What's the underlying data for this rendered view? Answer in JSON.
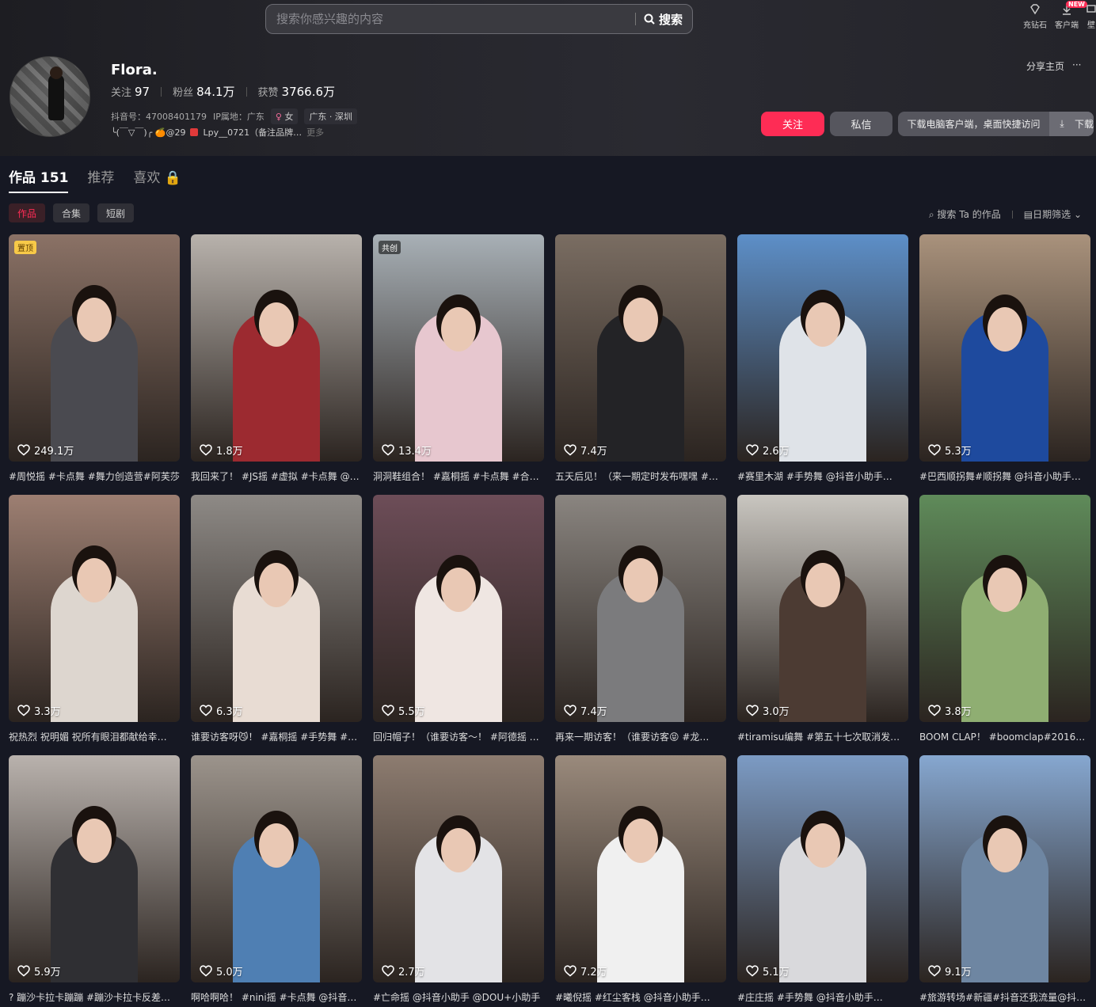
{
  "search": {
    "placeholder": "搜索你感兴趣的内容",
    "button": "搜索"
  },
  "topbar": {
    "recharge": "充钻石",
    "client": "客户端",
    "new_badge": "NEW",
    "extra": "壁"
  },
  "profile": {
    "name": "Flora.",
    "following_label": "关注",
    "following": "97",
    "fans_label": "粉丝",
    "fans": "84.1万",
    "likes_label": "获赞",
    "likes": "3766.6万",
    "douyin_id": "抖音号：47008401179",
    "ip": "IP属地：广东",
    "gender": "女",
    "location": "广东 · 深圳",
    "bio": "╰(￣▽￣)╭ 🍊@29",
    "bio_link": "Lpy__0721（备注品牌…",
    "more": "更多"
  },
  "header_actions": {
    "share": "分享主页",
    "more": "···",
    "follow": "关注",
    "message": "私信",
    "download_tip": "下载电脑客户端，桌面快捷访问",
    "download": "下载"
  },
  "tabs": [
    {
      "label": "作品 151"
    },
    {
      "label": "推荐"
    },
    {
      "label": "喜欢"
    }
  ],
  "subtabs": [
    {
      "label": "作品"
    },
    {
      "label": "合集"
    },
    {
      "label": "短剧"
    }
  ],
  "tools": {
    "search_works": "搜索 Ta 的作品",
    "date_filter": "日期筛选"
  },
  "videos": [
    {
      "likes": "249.1万",
      "caption": "#周悦摇 #卡点舞 #舞力创造营#阿芙莎",
      "badge": "置顶",
      "bg": "#8b7266",
      "shirt": "#4a4a50"
    },
    {
      "likes": "1.8万",
      "caption": "我回来了！ #JS摇 #虚拟 #卡点舞 @…",
      "bg": "#b8b2ac",
      "shirt": "#9c2a30"
    },
    {
      "likes": "13.4万",
      "caption": "洞洞鞋组合！ #嘉桐摇 #卡点舞 #合…",
      "badge": "共创",
      "bg": "#a8b0b6",
      "shirt": "#e7c7cf"
    },
    {
      "likes": "7.4万",
      "caption": "五天后见！（来一期定时发布嘿嘿 #…",
      "bg": "#7a6d62",
      "shirt": "#232326"
    },
    {
      "likes": "2.6万",
      "caption": "#赛里木湖 #手势舞 @抖音小助手…",
      "bg": "#5d8fc8",
      "shirt": "#dfe3e8"
    },
    {
      "likes": "5.3万",
      "caption": "#巴西顺拐舞#顺拐舞 @抖音小助手…",
      "bg": "#a9927c",
      "shirt": "#1e4a9e"
    },
    {
      "likes": "3.3万",
      "caption": "祝热烈 祝明媚 祝所有眼泪都献给幸…",
      "bg": "#9d7f72",
      "shirt": "#ddd6cf"
    },
    {
      "likes": "6.3万",
      "caption": "谁要访客呀😼！ #嘉桐摇 #手势舞 #…",
      "bg": "#8e8a86",
      "shirt": "#e8dcd3"
    },
    {
      "likes": "5.5万",
      "caption": "回归帽子！（谁要访客～！ #阿德摇 …",
      "bg": "#6d4d58",
      "shirt": "#efe6e2"
    },
    {
      "likes": "7.4万",
      "caption": "再来一期访客！（谁要访客😝 #龙…",
      "bg": "#8a8580",
      "shirt": "#7b7b7d"
    },
    {
      "likes": "3.0万",
      "caption": "#tiramisu编舞 #第五十七次取消发…",
      "bg": "#c9c6c0",
      "shirt": "#4c3b33"
    },
    {
      "likes": "3.8万",
      "caption": "BOOM CLAP！ #boomclap#2016…",
      "bg": "#5f8b5a",
      "shirt": "#8fae72"
    },
    {
      "likes": "5.9万",
      "caption": "? 蹦沙卡拉卡蹦蹦 #蹦沙卡拉卡反差…",
      "bg": "#b9b2ad",
      "shirt": "#2f2f33"
    },
    {
      "likes": "5.0万",
      "caption": "啊哈啊哈！ #nini摇 #卡点舞 @抖音…",
      "bg": "#9c948c",
      "shirt": "#4f7fb3"
    },
    {
      "likes": "2.7万",
      "caption": "#亡命摇 @抖音小助手 @DOU+小助手",
      "bg": "#8d7c70",
      "shirt": "#e3e3e6"
    },
    {
      "likes": "7.2万",
      "caption": "#曦倪摇 #红尘客栈 @抖音小助手…",
      "bg": "#9a8a7c",
      "shirt": "#f0f0f0"
    },
    {
      "likes": "5.1万",
      "caption": "#庄庄摇 #手势舞 @抖音小助手…",
      "bg": "#7c9bc4",
      "shirt": "#d9d9dc"
    },
    {
      "likes": "9.1万",
      "caption": "#旅游转场#新疆#抖音还我流量@抖…",
      "bg": "#86a7d0",
      "shirt": "#6e86a2"
    }
  ]
}
